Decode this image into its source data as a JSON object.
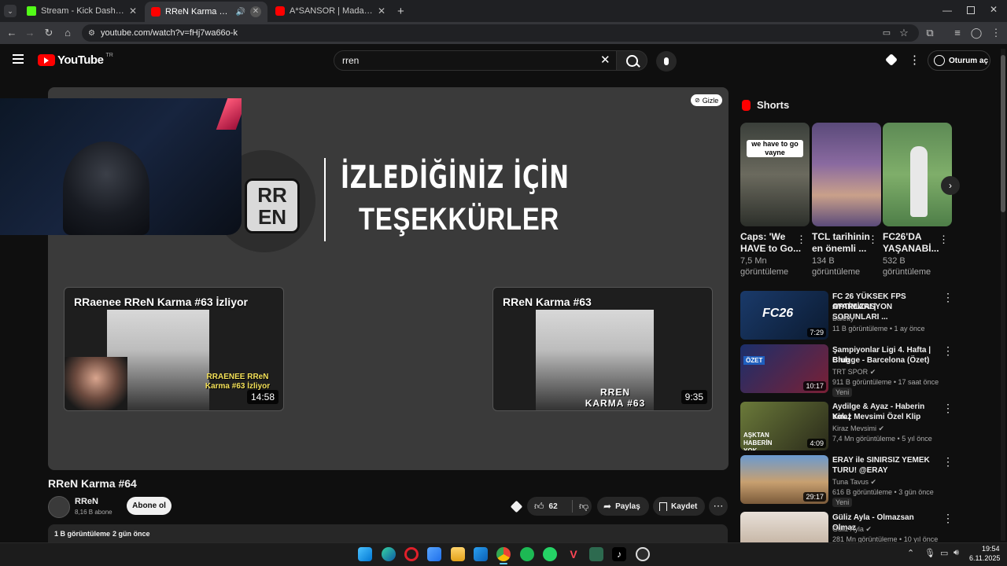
{
  "browser": {
    "tabs": [
      {
        "title": "Stream - Kick Dashboard",
        "favicon_color": "#53fc18"
      },
      {
        "title": "RReN Karma #64 - YouTube",
        "favicon_color": "#ff0000"
      },
      {
        "title": "A*SANSOR | Madara Olduk #5",
        "favicon_color": "#ff0000"
      }
    ],
    "url": "youtube.com/watch?v=fHj7wa66o-k"
  },
  "youtube": {
    "logo_text": "YouTube",
    "region": "TR",
    "search_value": "rren",
    "signin_label": "Oturum aç"
  },
  "player": {
    "hide_label": "Gizle",
    "end_screen_line1": "İZLEDİĞİNİZ İÇİN",
    "end_screen_line2": "TEŞEKKÜRLER",
    "logo_letters": "RR EN",
    "endcards": [
      {
        "title": "RRaenee RReN Karma #63 İzliyor",
        "duration": "14:58",
        "overlay": "RRAENEE RReN Karma #63 İzliyor"
      },
      {
        "title": "RReN Karma #63",
        "duration": "9:35",
        "overlay": "RREN KARMA #63"
      }
    ]
  },
  "video": {
    "title": "RReN Karma #64",
    "channel": "RReN",
    "subscribers": "8,16 B abone",
    "subscribe_label": "Abone ol",
    "likes": "62",
    "share_label": "Paylaş",
    "save_label": "Kaydet",
    "views": "1 B görüntüleme",
    "age": "2 gün önce"
  },
  "shorts": {
    "heading": "Shorts",
    "items": [
      {
        "title1": "Caps: 'We",
        "title2": "HAVE to Go...",
        "views1": "7,5 Mn",
        "views2": "görüntüleme",
        "overlay": "we have to go vayne"
      },
      {
        "title1": "TCL tarihinin",
        "title2": "en önemli ...",
        "views1": "134 B",
        "views2": "görüntüleme",
        "overlay": ""
      },
      {
        "title1": "FC26'DA",
        "title2": "YAŞANABİ...",
        "views1": "532 B",
        "views2": "görüntüleme",
        "overlay": ""
      }
    ]
  },
  "recommendations": [
    {
      "title1": "FC 26 YÜKSEK FPS AYARLARI |",
      "title2": "OPTİMİZASYON SORUNLARI ...",
      "channel": "Baletty",
      "meta": "11 B görüntüleme • 1 ay önce",
      "duration": "7:29",
      "badge": "",
      "verified": false,
      "thumb_text": "FC26"
    },
    {
      "title1": "Şampiyonlar Ligi 4. Hafta | Club",
      "title2": "Brugge - Barcelona (Özet)",
      "channel": "TRT SPOR",
      "meta": "911 B görüntüleme • 17 saat önce",
      "duration": "10:17",
      "badge": "Yeni",
      "verified": true,
      "thumb_text": "ÖZET"
    },
    {
      "title1": "Aydilge & Ayaz - Haberin Yok |",
      "title2": "Kiraz Mevsimi Özel Klip",
      "channel": "Kiraz Mevsimi",
      "meta": "7,4 Mn görüntüleme • 5 yıl önce",
      "duration": "4:09",
      "badge": "",
      "verified": true,
      "thumb_text": "AŞKTAN HABERİN YOK"
    },
    {
      "title1": "ERAY ile SINIRSIZ YEMEK",
      "title2": "TURU! @ERAY",
      "channel": "Tuna Tavus",
      "meta": "616 B görüntüleme • 3 gün önce",
      "duration": "29:17",
      "badge": "Yeni",
      "verified": true,
      "thumb_text": ""
    },
    {
      "title1": "Güliz Ayla - Olmazsan Olmaz",
      "title2": "",
      "channel": "Güliz Ayla",
      "meta": "281 Mn görüntüleme • 10 yıl önce",
      "duration": "",
      "badge": "",
      "verified": true,
      "thumb_text": ""
    }
  ],
  "taskbar": {
    "time": "19:54",
    "date": "6.11.2025"
  }
}
